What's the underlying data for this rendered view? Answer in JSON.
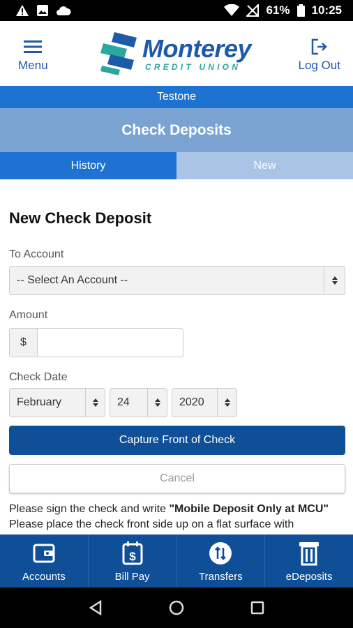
{
  "status_bar": {
    "battery": "61%",
    "time": "10:25"
  },
  "header": {
    "menu_label": "Menu",
    "logo_name": "Monterey",
    "logo_sub": "CREDIT UNION",
    "logout_label": "Log Out"
  },
  "user_bar": {
    "username": "Testone"
  },
  "page_title": "Check Deposits",
  "tabs": [
    {
      "label": "History",
      "active": true
    },
    {
      "label": "New",
      "active": false
    }
  ],
  "form": {
    "title": "New Check Deposit",
    "to_account_label": "To Account",
    "to_account_value": "-- Select An Account --",
    "amount_label": "Amount",
    "amount_prefix": "$",
    "amount_value": "",
    "check_date_label": "Check Date",
    "month": "February",
    "day": "24",
    "year": "2020",
    "capture_button": "Capture Front of Check",
    "cancel_button": "Cancel",
    "instruction_1_prefix": "Please sign the check and write ",
    "instruction_1_bold": "\"Mobile Deposit Only at MCU\"",
    "instruction_2": "Please place the check front side up on a flat surface with"
  },
  "bottom_nav": [
    {
      "label": "Accounts",
      "icon": "wallet-icon"
    },
    {
      "label": "Bill Pay",
      "icon": "bill-pay-icon"
    },
    {
      "label": "Transfers",
      "icon": "transfer-icon"
    },
    {
      "label": "eDeposits",
      "icon": "edeposit-icon"
    }
  ],
  "colors": {
    "brand_blue": "#1d5aa8",
    "brand_teal": "#2aa7a1",
    "user_bar": "#1e73d2",
    "title_bar": "#7aa3d1",
    "nav_bar": "#0f4f97"
  }
}
